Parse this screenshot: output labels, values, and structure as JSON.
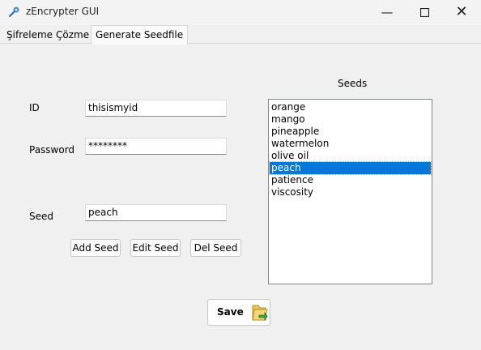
{
  "window": {
    "title": "zEncrypter GUI",
    "icon": "key-wrench-icon"
  },
  "tabs": [
    {
      "label": "Şifreleme"
    },
    {
      "label": "Çözme"
    },
    {
      "label": "Generate Seedfile",
      "active": true
    }
  ],
  "form": {
    "id_label": "ID",
    "id_value": "thisismyid",
    "password_label": "Password",
    "password_value": "********",
    "seed_label": "Seed",
    "seed_value": "peach"
  },
  "buttons": {
    "add": "Add Seed",
    "edit": "Edit Seed",
    "delete": "Del Seed",
    "save": "Save"
  },
  "seeds": {
    "title": "Seeds",
    "items": [
      "orange",
      "mango",
      "pineapple",
      "watermelon",
      "olive oil",
      "peach",
      "patience",
      "viscosity"
    ],
    "selected": "peach"
  },
  "colors": {
    "selection": "#0078d7",
    "background": "#f0f0f0"
  }
}
